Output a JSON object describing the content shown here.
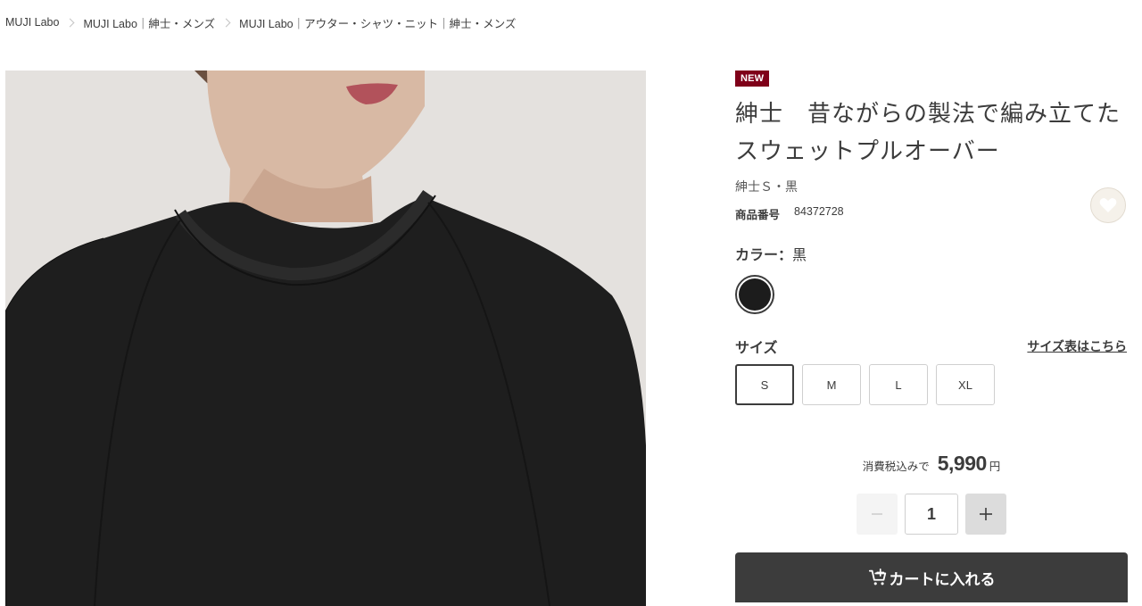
{
  "breadcrumb": [
    {
      "label": "MUJI Labo"
    },
    {
      "label": "MUJI Labo｜紳士・メンズ"
    },
    {
      "label": "MUJI Labo｜アウター・シャツ・ニット｜紳士・メンズ"
    }
  ],
  "product": {
    "badge": "NEW",
    "title_line1": "紳士　昔ながらの製法で編み立てた",
    "title_line2": "スウェットプルオーバー",
    "variant": "紳士Ｓ・黒",
    "product_no_label": "商品番号",
    "product_no": "84372728"
  },
  "color": {
    "label": "カラー：",
    "value": "黒",
    "swatches": [
      {
        "hex": "#1c1c1c",
        "selected": true
      }
    ]
  },
  "size": {
    "label": "サイズ",
    "chart_link": "サイズ表はこちら",
    "options": [
      "S",
      "M",
      "L",
      "XL"
    ],
    "selected": "S"
  },
  "price": {
    "note": "消費税込みで",
    "value": "5,990",
    "unit": "円"
  },
  "quantity": {
    "value": "1",
    "minus": "−",
    "plus": "+"
  },
  "cart": {
    "label": "カートに入れる"
  },
  "icons": {
    "favorite": "heart-icon",
    "cart": "cart-add-icon"
  },
  "colors": {
    "badge": "#7f0019",
    "primary": "#3c3c3c"
  }
}
